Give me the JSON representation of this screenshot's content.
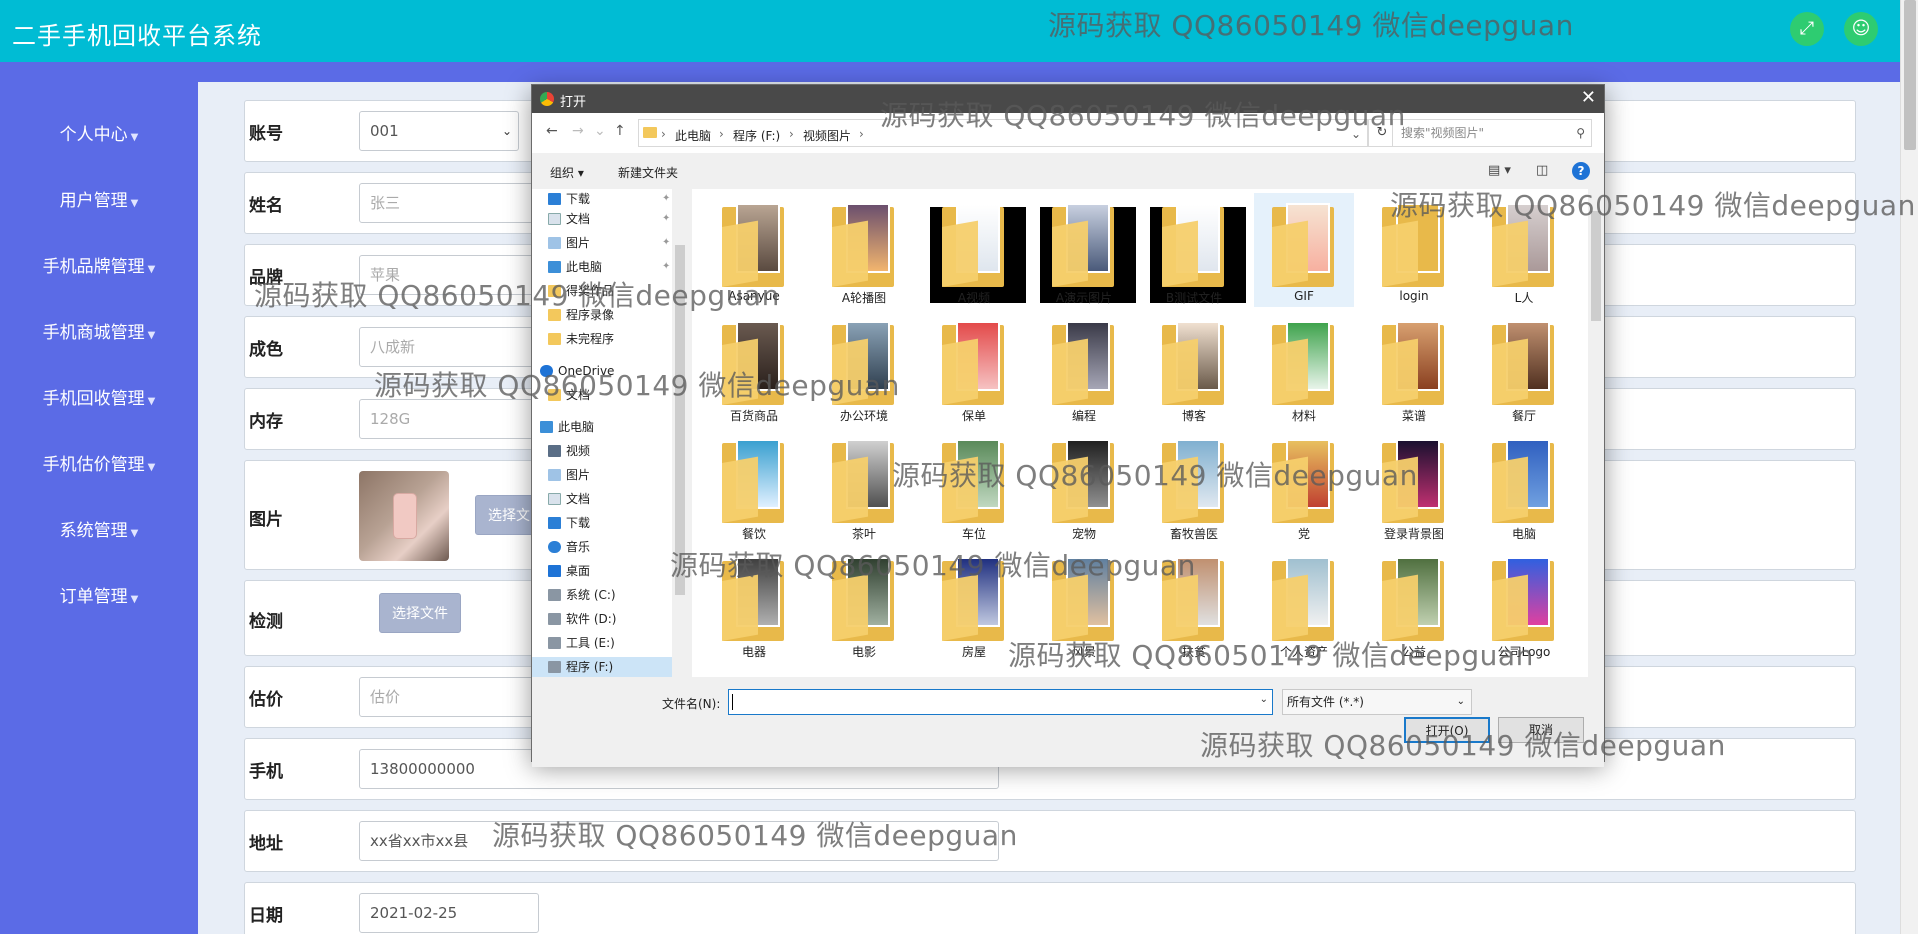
{
  "app": {
    "title": "二手手机回收平台系统"
  },
  "header": {
    "fullscreen_icon": "fullscreen-icon",
    "user_icon": "user-icon"
  },
  "sidebar": {
    "items": [
      {
        "label": "个人中心"
      },
      {
        "label": "用户管理"
      },
      {
        "label": "手机品牌管理"
      },
      {
        "label": "手机商城管理"
      },
      {
        "label": "手机回收管理"
      },
      {
        "label": "手机估价管理"
      },
      {
        "label": "系统管理"
      },
      {
        "label": "订单管理"
      }
    ]
  },
  "form": {
    "account": {
      "label": "账号",
      "value": "001"
    },
    "name": {
      "label": "姓名",
      "value": "张三"
    },
    "brand": {
      "label": "品牌",
      "value": "苹果"
    },
    "condition": {
      "label": "成色",
      "value": "八成新"
    },
    "memory": {
      "label": "内存",
      "value": "128G"
    },
    "picture": {
      "label": "图片",
      "button": "选择文"
    },
    "detection": {
      "label": "检测",
      "button": "选择文件"
    },
    "estimate": {
      "label": "估价",
      "placeholder": "估价"
    },
    "phone": {
      "label": "手机",
      "value": "13800000000"
    },
    "address": {
      "label": "地址",
      "value": "xx省xx市xx县"
    },
    "date": {
      "label": "日期",
      "value": "2021-02-25"
    }
  },
  "dialog": {
    "title": "打开",
    "breadcrumb": [
      "此电脑",
      "程序 (F:)",
      "视频图片"
    ],
    "search_placeholder": "搜索\"视频图片\"",
    "toolbar": {
      "organize": "组织",
      "new_folder": "新建文件夹"
    },
    "nav": [
      {
        "label": "下载",
        "pinned": true
      },
      {
        "label": "文档",
        "pinned": true
      },
      {
        "label": "图片",
        "pinned": true
      },
      {
        "label": "此电脑",
        "pinned": true
      },
      {
        "label": "得奖作品",
        "pinned": false
      },
      {
        "label": "程序录像",
        "pinned": false
      },
      {
        "label": "未完程序",
        "pinned": false
      },
      {
        "label": "OneDrive",
        "pinned": false
      },
      {
        "label": "文档",
        "pinned": false
      },
      {
        "label": "此电脑",
        "pinned": false
      },
      {
        "label": "视频",
        "pinned": false
      },
      {
        "label": "图片",
        "pinned": false
      },
      {
        "label": "文档",
        "pinned": false
      },
      {
        "label": "下载",
        "pinned": false
      },
      {
        "label": "音乐",
        "pinned": false
      },
      {
        "label": "桌面",
        "pinned": false
      },
      {
        "label": "系统 (C:)",
        "pinned": false
      },
      {
        "label": "软件 (D:)",
        "pinned": false
      },
      {
        "label": "工具 (E:)",
        "pinned": false
      },
      {
        "label": "程序 (F:)",
        "pinned": false
      }
    ],
    "files": [
      "Asanyue",
      "A轮播图",
      "A视频",
      "A演示图片",
      "B测试文件",
      "GIF",
      "login",
      "L人",
      "百货商品",
      "办公环境",
      "保单",
      "编程",
      "博客",
      "材料",
      "菜谱",
      "餐厅",
      "餐饮",
      "茶叶",
      "车位",
      "宠物",
      "畜牧兽医",
      "党",
      "登录背景图",
      "电脑",
      "电器",
      "电影",
      "房屋",
      "风景",
      "扶贫",
      "个人资产",
      "公益",
      "公司Logo"
    ],
    "filename_label": "文件名(N):",
    "filetype": "所有文件 (*.*)",
    "open_button": "打开(O)",
    "cancel_button": "取消"
  },
  "watermarks": [
    "源码获取 QQ86050149 微信deepguan",
    "源码获取 QQ86050149 微信deepguan",
    "源码获取 QQ86050149 微信deepguan",
    "源码获取 QQ86050149 微信deepguan",
    "源码获取 QQ86050149 微信deepguan",
    "源码获取 QQ86050149 微信deepguan",
    "源码获取 QQ86050149 微信deepguan",
    "源码获取 QQ86050149 微信deepguan",
    "源码获取 QQ86050149 微信deepguan",
    "源码获取 QQ86050149 微信deepguan"
  ]
}
